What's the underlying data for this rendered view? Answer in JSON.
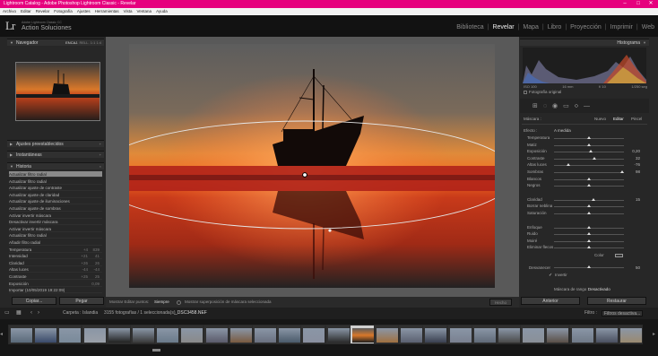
{
  "window": {
    "title": "Lightroom Catalog - Adobe Photoshop Lightroom Classic - Revelar",
    "minimize": "–",
    "maximize": "□",
    "close": "✕"
  },
  "menu": [
    "Archivo",
    "Editar",
    "Revelar",
    "Fotografía",
    "Ajustes",
    "Herramientas",
    "Vista",
    "Ventana",
    "Ayuda"
  ],
  "identity": {
    "logo": "Lr",
    "line1": "Adobe Lightroom Classic CC",
    "line2": "Action Soluciones"
  },
  "modules": [
    "Biblioteca",
    "Revelar",
    "Mapa",
    "Libro",
    "Proyección",
    "Imprimir",
    "Web"
  ],
  "active_module": "Revelar",
  "left": {
    "navigator": {
      "title": "Navegador",
      "zoom_options": [
        "ENCAJ.",
        "RELL.",
        "1:1",
        "1:4"
      ]
    },
    "presets": "Ajustes preestablecidos",
    "snapshots": "Instantáneas",
    "history_title": "Historia",
    "history": [
      {
        "label": "Actualizar filtro radial",
        "v1": "",
        "v2": ""
      },
      {
        "label": "Actualizar filtro radial",
        "v1": "",
        "v2": ""
      },
      {
        "label": "Actualizar ajuste de contraste",
        "v1": "",
        "v2": ""
      },
      {
        "label": "Actualizar ajuste de claridad",
        "v1": "",
        "v2": ""
      },
      {
        "label": "Actualizar ajuste de iluminaciones",
        "v1": "",
        "v2": ""
      },
      {
        "label": "Actualizar ajuste de sombras",
        "v1": "",
        "v2": ""
      },
      {
        "label": "Activar invertir máscara",
        "v1": "",
        "v2": ""
      },
      {
        "label": "Desactivar invertir máscara",
        "v1": "",
        "v2": ""
      },
      {
        "label": "Activar invertir máscara",
        "v1": "",
        "v2": ""
      },
      {
        "label": "Actualizar filtro radial",
        "v1": "",
        "v2": ""
      },
      {
        "label": "Añadir filtro radial",
        "v1": "",
        "v2": ""
      },
      {
        "label": "Temperatura",
        "v1": "+4",
        "v2": "839"
      },
      {
        "label": "Intensidad",
        "v1": "+21",
        "v2": "41"
      },
      {
        "label": "Claridad",
        "v1": "+26",
        "v2": "26"
      },
      {
        "label": "Altas luces",
        "v1": "-44",
        "v2": "-44"
      },
      {
        "label": "Contraste",
        "v1": "+25",
        "v2": "25"
      },
      {
        "label": "Exposición",
        "v1": "",
        "v2": "0,09"
      },
      {
        "label": "Importar (10/05/2019 19:22:09)",
        "v1": "",
        "v2": ""
      }
    ],
    "copy": "Copiar...",
    "paste": "Pegar"
  },
  "toolbar": {
    "mask_label": "Mostrar Editar puntos:",
    "mask_value": "Siempre",
    "overlay_label": "Mostrar superposición de máscara seleccionada",
    "done": "Hecho"
  },
  "right": {
    "histogram_title": "Histograma",
    "hist_info": [
      "ISO 100",
      "16 mm",
      "f/ 10",
      "1/250 seg"
    ],
    "original": "Fotografía original",
    "mask_label": "Máscara :",
    "mask_new": "Nuevo",
    "mask_edit": "Editar",
    "mask_brush": "Pincel",
    "effect": "Efecto :",
    "effect_value": "A medida",
    "sliders": [
      {
        "label": "Temperatura",
        "value": "",
        "pos": 0.5
      },
      {
        "label": "Matiz",
        "value": "",
        "pos": 0.5
      },
      {
        "label": "Exposición",
        "value": "0,20",
        "pos": 0.53
      },
      {
        "label": "Contraste",
        "value": "32",
        "pos": 0.58
      },
      {
        "label": "Altas luces",
        "value": "-76",
        "pos": 0.2
      },
      {
        "label": "Sombras",
        "value": "98",
        "pos": 0.98
      },
      {
        "label": "Blancos",
        "value": "",
        "pos": 0.5
      },
      {
        "label": "Negros",
        "value": "",
        "pos": 0.5
      },
      {
        "label": "Claridad",
        "value": "15",
        "pos": 0.57
      },
      {
        "label": "Borrar neblina",
        "value": "",
        "pos": 0.5
      },
      {
        "label": "Saturación",
        "value": "",
        "pos": 0.5
      },
      {
        "label": "Enfoque",
        "value": "",
        "pos": 0.5
      },
      {
        "label": "Ruido",
        "value": "",
        "pos": 0.5
      },
      {
        "label": "Moiré",
        "value": "",
        "pos": 0.5
      },
      {
        "label": "Eliminar flecos",
        "value": "",
        "pos": 0.5
      }
    ],
    "color": "Color",
    "feather": "Desvanecer",
    "feather_value": "50",
    "feather_pos": 0.5,
    "invert": "Invertir",
    "range_mask": "Máscara de rango :",
    "range_value": "Desactivado",
    "prev": "Anterior",
    "reset": "Restaurar"
  },
  "filmstrip_bar": {
    "left": "Carpeta : Islandia",
    "count": "3155 fotografías / 1 seleccionada(s)",
    "file": "_DSC3458.NEF",
    "filter_label": "Filtro :",
    "filter_value": "Filtros desactiva..."
  }
}
